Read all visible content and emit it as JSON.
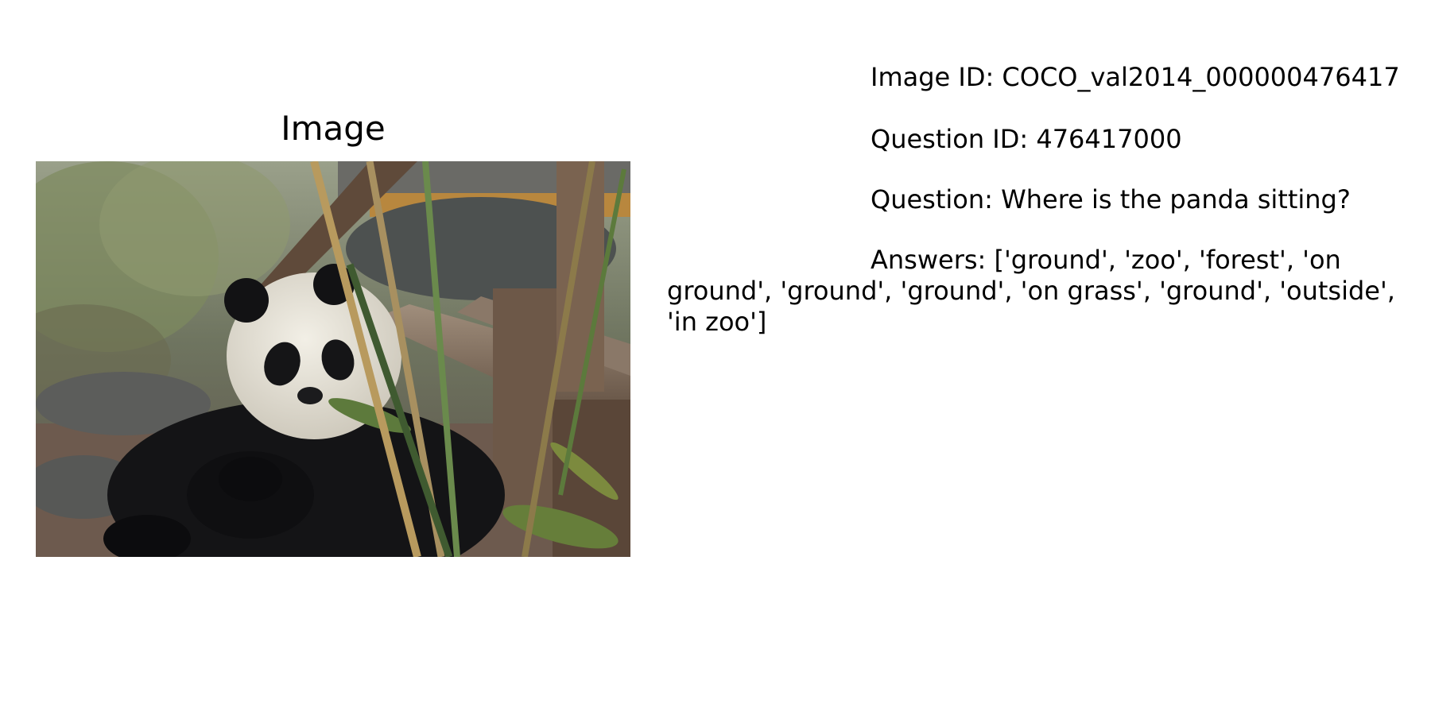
{
  "figure": {
    "image_title": "Image",
    "image_id_label": "Image ID:",
    "image_id": "COCO_val2014_000000476417",
    "question_id_label": "Question ID:",
    "question_id": "476417000",
    "question_label": "Question:",
    "question": "Where is the panda sitting?",
    "answers_label": "Answers:",
    "answers": "['ground', 'zoo', 'forest', 'on ground', 'ground', 'ground', 'on grass', 'ground', 'outside', 'in zoo']"
  },
  "photo": {
    "subject": "panda eating bamboo beside wooden log fence"
  }
}
